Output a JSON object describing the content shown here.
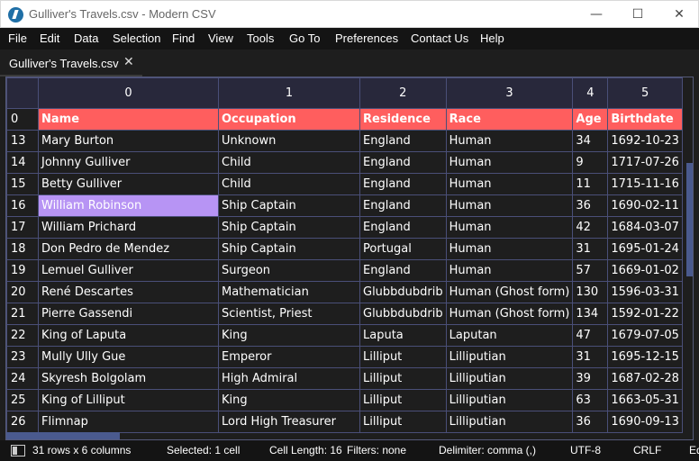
{
  "window": {
    "title": "Gulliver's Travels.csv - Modern CSV",
    "minimize_glyph": "—",
    "maximize_glyph": "☐",
    "close_glyph": "✕"
  },
  "menu": [
    "File",
    "Edit",
    "Data",
    "Selection",
    "Find",
    "View",
    "Tools",
    "Go To",
    "Preferences",
    "Contact Us",
    "Help"
  ],
  "tab": {
    "label": "Gulliver's Travels.csv",
    "close_glyph": "✕"
  },
  "grid": {
    "column_indices": [
      "0",
      "1",
      "2",
      "3",
      "4",
      "5"
    ],
    "rows": [
      {
        "num": "0",
        "cells": [
          "Name",
          "Occupation",
          "Residence",
          "Race",
          "Age",
          "Birthdate"
        ],
        "header": true
      },
      {
        "num": "13",
        "cells": [
          "Mary Burton",
          "Unknown",
          "England",
          "Human",
          "34",
          "1692-10-23"
        ]
      },
      {
        "num": "14",
        "cells": [
          "Johnny Gulliver",
          "Child",
          "England",
          "Human",
          "9",
          "1717-07-26"
        ]
      },
      {
        "num": "15",
        "cells": [
          "Betty Gulliver",
          "Child",
          "England",
          "Human",
          "11",
          "1715-11-16"
        ]
      },
      {
        "num": "16",
        "cells": [
          "William Robinson",
          "Ship Captain",
          "England",
          "Human",
          "36",
          "1690-02-11"
        ],
        "selected_col": 0
      },
      {
        "num": "17",
        "cells": [
          "William Prichard",
          "Ship Captain",
          "England",
          "Human",
          "42",
          "1684-03-07"
        ]
      },
      {
        "num": "18",
        "cells": [
          "Don Pedro de Mendez",
          "Ship Captain",
          "Portugal",
          "Human",
          "31",
          "1695-01-24"
        ]
      },
      {
        "num": "19",
        "cells": [
          "Lemuel Gulliver",
          "Surgeon",
          "England",
          "Human",
          "57",
          "1669-01-02"
        ]
      },
      {
        "num": "20",
        "cells": [
          "René Descartes",
          "Mathematician",
          "Glubbdubdrib",
          "Human (Ghost form)",
          "130",
          "1596-03-31"
        ]
      },
      {
        "num": "21",
        "cells": [
          "Pierre Gassendi",
          "Scientist, Priest",
          "Glubbdubdrib",
          "Human (Ghost form)",
          "134",
          "1592-01-22"
        ]
      },
      {
        "num": "22",
        "cells": [
          "King of Laputa",
          "King",
          "Laputa",
          "Laputan",
          "47",
          "1679-07-05"
        ]
      },
      {
        "num": "23",
        "cells": [
          "Mully Ully Gue",
          "Emperor",
          "Lilliput",
          "Lilliputian",
          "31",
          "1695-12-15"
        ]
      },
      {
        "num": "24",
        "cells": [
          "Skyresh Bolgolam",
          "High Admiral",
          "Lilliput",
          "Lilliputian",
          "39",
          "1687-02-28"
        ]
      },
      {
        "num": "25",
        "cells": [
          "King of Lilliput",
          "King",
          "Lilliput",
          "Lilliputian",
          "63",
          "1663-05-31"
        ]
      },
      {
        "num": "26",
        "cells": [
          "Flimnap",
          "Lord High Treasurer",
          "Lilliput",
          "Lilliputian",
          "36",
          "1690-09-13"
        ]
      }
    ]
  },
  "status": {
    "rows_cols": "31 rows x 6 columns",
    "selected": "Selected: 1 cell",
    "cell_length": "Cell Length: 16",
    "filters": "Filters: none",
    "delimiter": "Delimiter: comma (,)",
    "encoding": "UTF-8",
    "line_ending": "CRLF",
    "overflow": "Ed"
  },
  "colors": {
    "header_row": "#ff5e5e",
    "selected_cell": "#b794f4",
    "grid_line": "#4a4f78",
    "column_header_bg": "#28283b",
    "scrollbar": "#4a5a8e"
  }
}
